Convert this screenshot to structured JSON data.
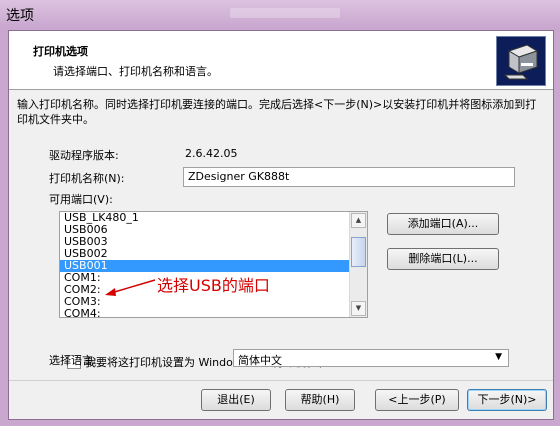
{
  "window": {
    "title": "选项"
  },
  "header": {
    "title": "打印机选项",
    "subtitle": "请选择端口、打印机名称和语言。",
    "icon": "printer-icon"
  },
  "description": "输入打印机名称。同时选择打印机要连接的端口。完成后选择<下一步(N)>以安装打印机并将图标添加到打印机文件夹中。",
  "driver": {
    "label": "驱动程序版本:",
    "value": "2.6.42.05"
  },
  "printer_name": {
    "label": "打印机名称(N):",
    "value": "ZDesigner GK888t"
  },
  "ports": {
    "label": "可用端口(V):",
    "items": [
      "USB_LK480_1",
      "USB006",
      "USB003",
      "USB002",
      "USB001",
      "COM1:",
      "COM2:",
      "COM3:",
      "COM4:"
    ],
    "selected": "USB001"
  },
  "annotation": {
    "text": "选择USB的端口",
    "color": "#d40000"
  },
  "buttons": {
    "add_port": "添加端口(A)...",
    "delete_port": "删除端口(L)...",
    "exit": "退出(E)",
    "help": "帮助(H)",
    "back": "<上一步(P)",
    "next": "下一步(N)>"
  },
  "default_printer": {
    "label": "我要将这打印机设置为 Windows 默认打印机(D).",
    "checked": false
  },
  "language": {
    "label": "选择语言:",
    "value": "简体中文"
  },
  "colors": {
    "selection": "#3399ff",
    "frame": "#c9a7cf",
    "icon_bg": "#0d1d5a"
  }
}
